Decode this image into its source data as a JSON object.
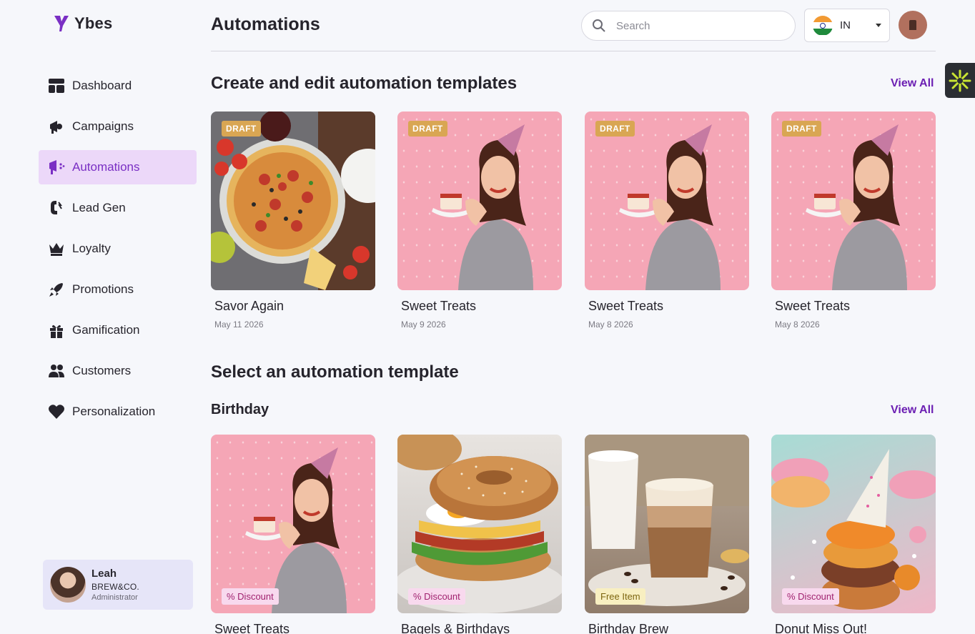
{
  "app": {
    "name": "Ybes"
  },
  "nav": {
    "items": [
      {
        "label": "Dashboard",
        "icon": "dashboard-icon",
        "active": false
      },
      {
        "label": "Campaigns",
        "icon": "megaphone-icon",
        "active": false
      },
      {
        "label": "Automations",
        "icon": "automation-icon",
        "active": true
      },
      {
        "label": "Lead Gen",
        "icon": "magnet-icon",
        "active": false
      },
      {
        "label": "Loyalty",
        "icon": "crown-icon",
        "active": false
      },
      {
        "label": "Promotions",
        "icon": "rocket-icon",
        "active": false
      },
      {
        "label": "Gamification",
        "icon": "gift-icon",
        "active": false
      },
      {
        "label": "Customers",
        "icon": "users-icon",
        "active": false
      },
      {
        "label": "Personalization",
        "icon": "heart-icon",
        "active": false
      }
    ]
  },
  "profile": {
    "name": "Leah",
    "company": "BREW&CO.",
    "role": "Administrator"
  },
  "header": {
    "title": "Automations",
    "search_placeholder": "Search",
    "country_code": "IN"
  },
  "templates_section": {
    "title": "Create and edit automation templates",
    "view_all": "View All",
    "cards": [
      {
        "badge": "DRAFT",
        "title": "Savor Again",
        "date": "May 11 2026",
        "image": "pizza"
      },
      {
        "badge": "DRAFT",
        "title": "Sweet Treats",
        "date": "May 9 2026",
        "image": "birthday-woman"
      },
      {
        "badge": "DRAFT",
        "title": "Sweet Treats",
        "date": "May 8 2026",
        "image": "birthday-woman"
      },
      {
        "badge": "DRAFT",
        "title": "Sweet Treats",
        "date": "May 8 2026",
        "image": "birthday-woman"
      }
    ]
  },
  "select_section": {
    "title": "Select an automation template",
    "category": "Birthday",
    "view_all": "View All",
    "cards": [
      {
        "tag": "% Discount",
        "title": "Sweet Treats",
        "image": "birthday-woman"
      },
      {
        "tag": "% Discount",
        "title": "Bagels & Birthdays",
        "image": "bagel"
      },
      {
        "tag": "Free Item",
        "title": "Birthday Brew",
        "image": "coffee"
      },
      {
        "tag": "% Discount",
        "title": "Donut Miss Out!",
        "image": "donuts"
      }
    ]
  },
  "colors": {
    "accent": "#6c1fb3",
    "active_bg": "#ecd8f9",
    "draft_badge": "#d9a653"
  }
}
